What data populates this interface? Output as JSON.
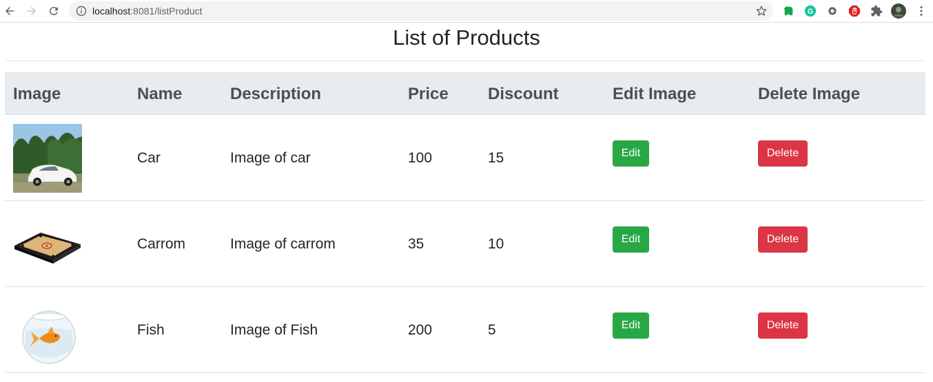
{
  "browser": {
    "url_host": "localhost",
    "url_path": ":8081/listProduct",
    "icons": [
      "back-icon",
      "forward-icon",
      "reload-icon",
      "info-icon",
      "star-icon",
      "evernote-icon",
      "grammarly-icon",
      "extension-icon",
      "adblock-icon",
      "puzzle-icon",
      "profile-avatar",
      "menu-icon"
    ]
  },
  "page": {
    "title": "List of Products"
  },
  "table": {
    "headers": [
      "Image",
      "Name",
      "Description",
      "Price",
      "Discount",
      "Edit Image",
      "Delete Image"
    ],
    "rows": [
      {
        "image": "car-image",
        "name": "Car",
        "description": "Image of car",
        "price": "100",
        "discount": "15",
        "edit": "Edit",
        "delete": "Delete"
      },
      {
        "image": "carrom-image",
        "name": "Carrom",
        "description": "Image of carrom",
        "price": "35",
        "discount": "10",
        "edit": "Edit",
        "delete": "Delete"
      },
      {
        "image": "fish-image",
        "name": "Fish",
        "description": "Image of Fish",
        "price": "200",
        "discount": "5",
        "edit": "Edit",
        "delete": "Delete"
      }
    ]
  },
  "colors": {
    "edit_button": "#28a745",
    "delete_button": "#dc3545",
    "header_bg": "#e9ecef"
  }
}
